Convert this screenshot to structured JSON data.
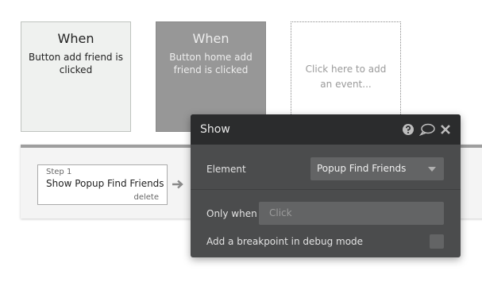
{
  "events": [
    {
      "title": "When",
      "description": "Button add friend is clicked"
    },
    {
      "title": "When",
      "description": "Button home add friend is clicked"
    }
  ],
  "add_event": {
    "label": "Click here to add an event..."
  },
  "step": {
    "number_label": "Step 1",
    "action_label": "Show Popup Find Friends",
    "delete_label": "delete"
  },
  "dialog": {
    "title": "Show",
    "element_label": "Element",
    "element_value": "Popup Find Friends",
    "only_when_label": "Only when",
    "only_when_placeholder": "Click",
    "breakpoint_label": "Add a breakpoint in debug mode",
    "breakpoint_checked": false
  },
  "icons": [
    "help-icon",
    "comment-icon",
    "close-icon",
    "arrow-right-icon",
    "chevron-down-icon"
  ],
  "colors": {
    "dialog_bg": "#4b4c4d",
    "dialog_header": "#2b2c2d",
    "selected_card": "#979797"
  }
}
